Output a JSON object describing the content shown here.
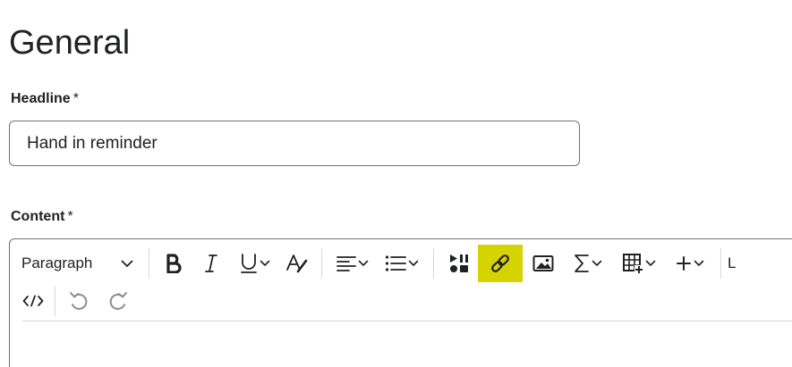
{
  "section": {
    "title": "General"
  },
  "headline": {
    "label": "Headline",
    "required_mark": "*",
    "value": "Hand in reminder"
  },
  "content": {
    "label": "Content",
    "required_mark": "*"
  },
  "toolbar": {
    "block_format": "Paragraph",
    "overflow_label": "L",
    "buttons": [
      {
        "name": "bold-button",
        "icon": "bold-icon"
      },
      {
        "name": "italic-button",
        "icon": "italic-icon"
      },
      {
        "name": "underline-button",
        "icon": "underline-icon",
        "dropdown": true
      },
      {
        "name": "clear-format-button",
        "icon": "format-clear-icon"
      },
      {
        "name": "align-button",
        "icon": "align-left-icon",
        "dropdown": true
      },
      {
        "name": "list-button",
        "icon": "bullet-list-icon",
        "dropdown": true
      },
      {
        "name": "insert-media-button",
        "icon": "media-icon"
      },
      {
        "name": "insert-link-button",
        "icon": "link-icon",
        "highlighted": true
      },
      {
        "name": "insert-image-button",
        "icon": "image-icon"
      },
      {
        "name": "equation-button",
        "icon": "sigma-icon",
        "dropdown": true
      },
      {
        "name": "table-button",
        "icon": "table-icon",
        "dropdown": true
      },
      {
        "name": "insert-more-button",
        "icon": "plus-icon",
        "dropdown": true
      },
      {
        "name": "source-code-button",
        "icon": "code-icon"
      },
      {
        "name": "undo-button",
        "icon": "undo-icon",
        "disabled": true
      },
      {
        "name": "redo-button",
        "icon": "redo-icon",
        "disabled": true
      }
    ]
  },
  "colors": {
    "highlight": "#d6d400",
    "text": "#202122",
    "border": "#6e7376",
    "disabled": "#8a8e92"
  }
}
